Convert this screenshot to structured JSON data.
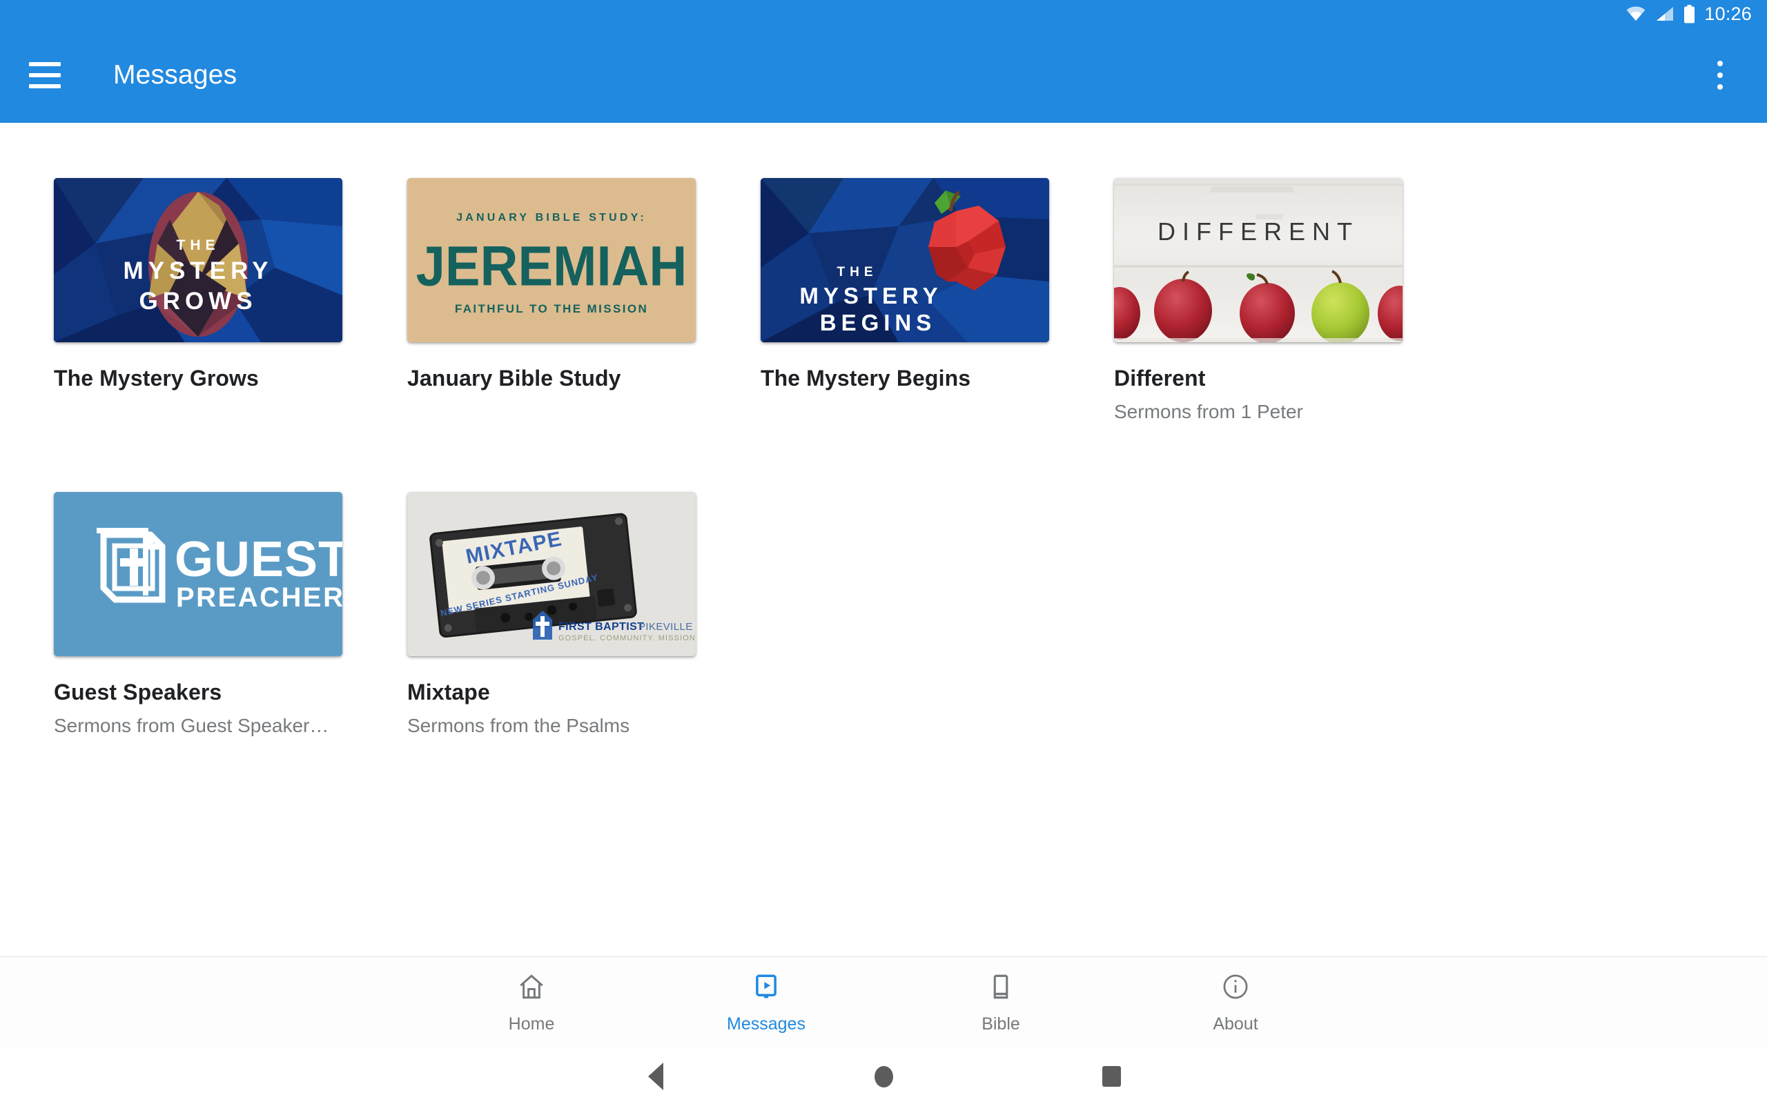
{
  "status_bar": {
    "time": "10:26",
    "icons": [
      "wifi-icon",
      "cell-signal-icon",
      "battery-icon"
    ]
  },
  "app_bar": {
    "title": "Messages",
    "menu_icon": "hamburger-menu-icon",
    "overflow_icon": "overflow-menu-icon",
    "background_color": "#2189e0"
  },
  "series": [
    {
      "title": "The Mystery Grows",
      "subtitle": "",
      "artwork": "the-mystery-grows-artwork",
      "artwork_text": [
        "THE",
        "MYSTERY",
        "GROWS"
      ],
      "artwork_colors": [
        "#102a6b",
        "#1452a8",
        "#0d3b8c",
        "#c6a358",
        "#8e3a4e"
      ]
    },
    {
      "title": "January Bible Study",
      "subtitle": "",
      "artwork": "january-bible-study-artwork",
      "artwork_text": [
        "JANUARY BIBLE STUDY:",
        "JEREMIAH",
        "FAITHFUL TO THE MISSION"
      ],
      "artwork_colors": [
        "#dcbc8e",
        "#15615e"
      ]
    },
    {
      "title": "The Mystery Begins",
      "subtitle": "",
      "artwork": "the-mystery-begins-artwork",
      "artwork_text": [
        "THE",
        "MYSTERY",
        "BEGINS"
      ],
      "artwork_colors": [
        "#102a6b",
        "#1452a8",
        "#d32a2a",
        "#4fa332"
      ]
    },
    {
      "title": "Different",
      "subtitle": "Sermons from 1 Peter",
      "artwork": "different-artwork",
      "artwork_text": [
        "DIFFERENT"
      ],
      "artwork_colors": [
        "#eceae6",
        "#b8252f",
        "#a8cc34"
      ]
    },
    {
      "title": "Guest Speakers",
      "subtitle": "Sermons from Guest Speaker…",
      "artwork": "guest-preacher-artwork",
      "artwork_text": [
        "GUEST",
        "PREACHER"
      ],
      "artwork_colors": [
        "#5a9bc6",
        "#ffffff"
      ]
    },
    {
      "title": "Mixtape",
      "subtitle": "Sermons from the Psalms",
      "artwork": "mixtape-cassette-artwork",
      "artwork_text": [
        "MIXTAPE",
        "NEW SERIES STARTING SUNDAY",
        "FIRST BAPTIST PIKEVILLE",
        "GOSPEL. COMMUNITY. MISSION."
      ],
      "artwork_colors": [
        "#dedcd8",
        "#2b2b2b",
        "#efece1",
        "#2c62b4"
      ]
    }
  ],
  "bottom_nav": {
    "active_color": "#2189e0",
    "inactive_color": "#76797c",
    "items": [
      {
        "label": "Home",
        "icon": "home-icon",
        "active": false
      },
      {
        "label": "Messages",
        "icon": "video-messages-icon",
        "active": true
      },
      {
        "label": "Bible",
        "icon": "book-icon",
        "active": false
      },
      {
        "label": "About",
        "icon": "info-icon",
        "active": false
      }
    ]
  },
  "system_nav": {
    "back": "back-triangle-icon",
    "home": "home-circle-icon",
    "recents": "recents-square-icon"
  }
}
